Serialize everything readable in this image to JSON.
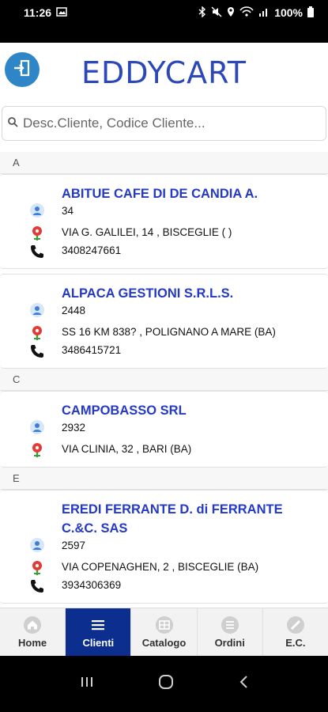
{
  "status_bar": {
    "time": "11:26",
    "battery": "100%"
  },
  "header": {
    "title": "EDDYCART"
  },
  "search": {
    "placeholder": "Desc.Cliente, Codice Cliente..."
  },
  "sections": [
    {
      "letter": "A",
      "clients": [
        {
          "name": "ABITUE CAFE DI DE CANDIA A.",
          "code": "34",
          "address": "VIA G. GALILEI, 14 , BISCEGLIE ( )",
          "phone": "3408247661"
        },
        {
          "name": "ALPACA GESTIONI S.R.L.S.",
          "code": "2448",
          "address": "SS 16 KM 838? , POLIGNANO A MARE (BA)",
          "phone": "3486415721"
        }
      ]
    },
    {
      "letter": "C",
      "clients": [
        {
          "name": "CAMPOBASSO SRL",
          "code": "2932",
          "address": "VIA CLINIA, 32 , BARI (BA)"
        }
      ]
    },
    {
      "letter": "E",
      "clients": [
        {
          "name": "EREDI FERRANTE D. di FERRANTE C.&C. SAS",
          "code": "2597",
          "address": "VIA COPENAGHEN, 2 , BISCEGLIE (BA)",
          "phone": "3934306369"
        }
      ]
    }
  ],
  "tabs": [
    {
      "label": "Home",
      "icon": "home-icon"
    },
    {
      "label": "Clienti",
      "icon": "list-icon",
      "active": true
    },
    {
      "label": "Catalogo",
      "icon": "catalog-icon"
    },
    {
      "label": "Ordini",
      "icon": "orders-icon"
    },
    {
      "label": "E.C.",
      "icon": "ec-icon"
    }
  ],
  "colors": {
    "accent": "#2c47b8",
    "client_name": "#2439c6",
    "active_tab": "#0c2f8f",
    "logout": "#2e86c7"
  }
}
